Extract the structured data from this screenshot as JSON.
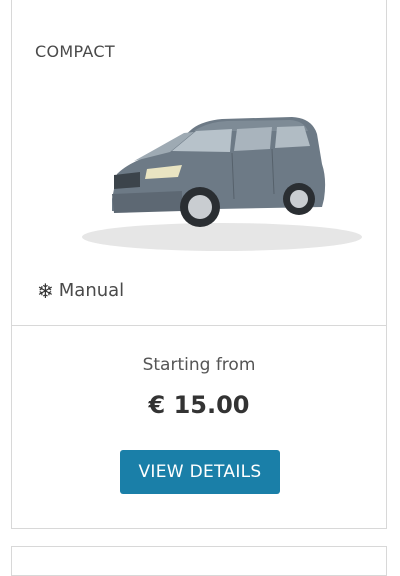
{
  "card": {
    "category": "COMPACT",
    "feature_icon": "snowflake-icon",
    "transmission": "Manual",
    "starting_label": "Starting from",
    "price": "€ 15.00",
    "button_label": "VIEW DETAILS",
    "button_color": "#1a7fa8"
  }
}
